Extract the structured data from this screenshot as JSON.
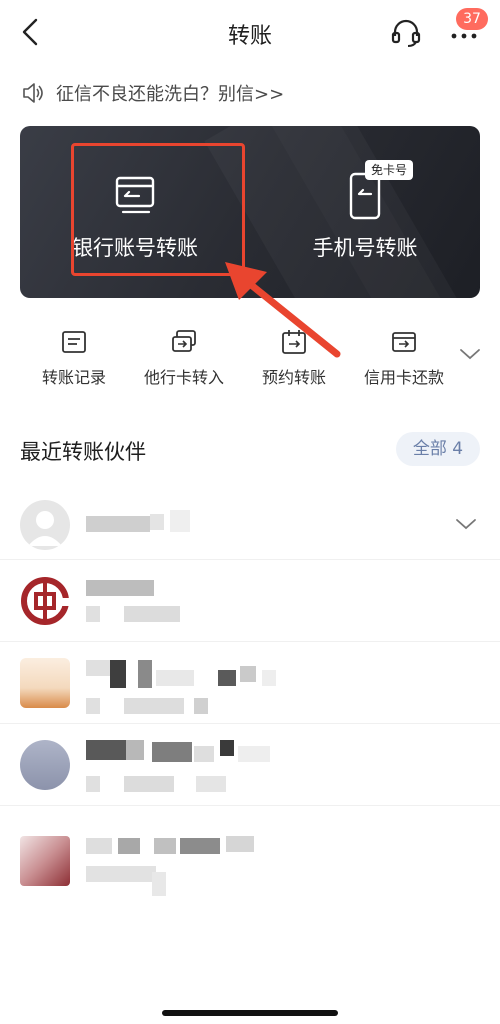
{
  "nav": {
    "title": "转账",
    "badge": "37",
    "icons": {
      "back": "chevron-left-icon",
      "support": "headset-icon",
      "more": "more-dots-icon"
    }
  },
  "notice": {
    "text": "征信不良还能洗白？别信>>",
    "icon": "speaker-icon"
  },
  "hero": {
    "bank_transfer_label": "银行账号转账",
    "phone_transfer_label": "手机号转账",
    "phone_transfer_tag": "免卡号",
    "icons": {
      "bank": "bank-card-transfer-icon",
      "phone": "phone-transfer-icon"
    }
  },
  "quick_actions": [
    {
      "label": "转账记录",
      "icon": "record-icon"
    },
    {
      "label": "他行卡转入",
      "icon": "card-in-icon"
    },
    {
      "label": "预约转账",
      "icon": "calendar-transfer-icon"
    },
    {
      "label": "信用卡还款",
      "icon": "credit-card-repay-icon"
    }
  ],
  "recent": {
    "title": "最近转账伙伴",
    "all_label": "全部 4"
  },
  "colors": {
    "accent_red": "#e9452f",
    "badge": "#ff6b5e",
    "pill_bg": "#eef2f8",
    "pill_text": "#6a7fa8"
  }
}
